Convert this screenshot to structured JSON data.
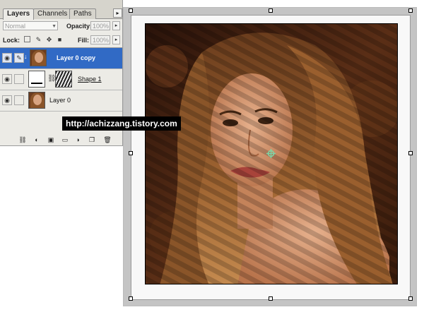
{
  "layers_panel": {
    "tabs": [
      "Layers",
      "Channels",
      "Paths"
    ],
    "active_tab": "Layers",
    "blend_mode": "Normal",
    "opacity_label": "Opacity:",
    "opacity_value": "100%",
    "lock_label": "Lock:",
    "fill_label": "Fill:",
    "fill_value": "100%",
    "layers": [
      {
        "name": "Layer 0 copy",
        "selected": true
      },
      {
        "name": "Shape 1",
        "selected": false
      },
      {
        "name": "Layer 0",
        "selected": false
      }
    ],
    "bottom_icons": [
      "link-icon",
      "fx-icon",
      "mask-icon",
      "group-icon",
      "adjustment-icon",
      "new-layer-icon",
      "trash-icon"
    ]
  },
  "watermark": "http://achizzang.tistory.com",
  "colors": {
    "selection_blue": "#316ac5",
    "panel_bg": "#ecebe6",
    "canvas_frame": "#c4c4c4",
    "crosshair": "#7fd4a6"
  }
}
